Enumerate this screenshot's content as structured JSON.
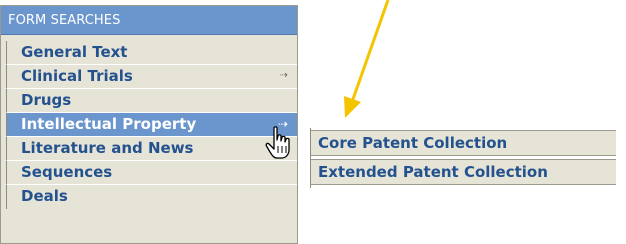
{
  "menu": {
    "header": "FORM SEARCHES",
    "items": [
      {
        "label": "General Text",
        "has_submenu": false
      },
      {
        "label": "Clinical Trials",
        "has_submenu": true,
        "arrow": "⇢"
      },
      {
        "label": "Drugs",
        "has_submenu": false
      },
      {
        "label": "Intellectual Property",
        "has_submenu": true,
        "active": true,
        "arrow": "⇢"
      },
      {
        "label": "Literature and News",
        "has_submenu": false
      },
      {
        "label": "Sequences",
        "has_submenu": false
      },
      {
        "label": "Deals",
        "has_submenu": false
      }
    ]
  },
  "submenu": {
    "items": [
      {
        "label": "Core Patent Collection"
      },
      {
        "label": "Extended Patent Collection"
      }
    ]
  },
  "colors": {
    "header_bg": "#6a96cd",
    "item_bg": "#e6e4d6",
    "item_text": "#24528f",
    "annotation_arrow": "#f5c400"
  },
  "icons": {
    "submenu_indicator": "dotted-right-arrow-icon",
    "pointer": "hand-pointer-cursor-icon",
    "annotation": "yellow-arrow-icon"
  }
}
